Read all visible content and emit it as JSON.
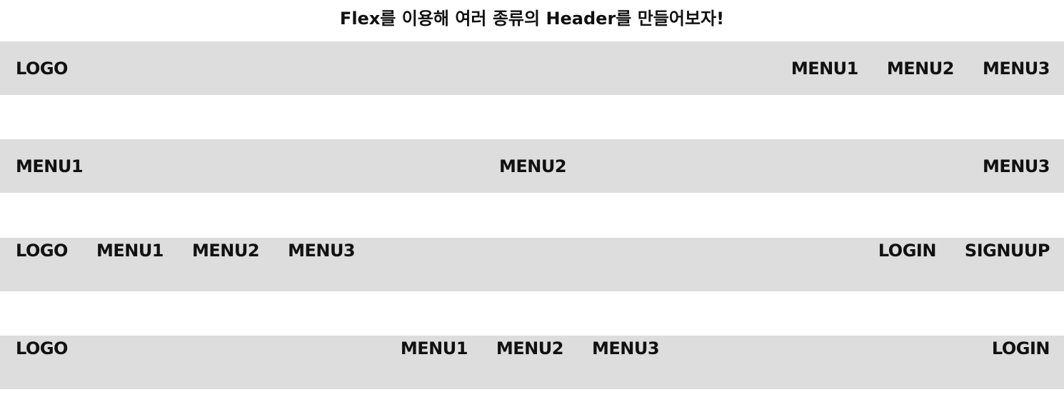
{
  "title": "Flex를 이용해 여러 종류의 Header를 만들어보자!",
  "colors": {
    "header_background": "#dddddd",
    "text": "#111111",
    "page_background": "#ffffff"
  },
  "header1": {
    "logo": "LOGO",
    "menus": [
      "MENU1",
      "MENU2",
      "MENU3"
    ]
  },
  "header2": {
    "menus": [
      "MENU1",
      "MENU2",
      "MENU3"
    ]
  },
  "header3": {
    "logo": "LOGO",
    "menus": [
      "MENU1",
      "MENU2",
      "MENU3"
    ],
    "login": "LOGIN",
    "signup": "SIGNUUP"
  },
  "header4": {
    "logo": "LOGO",
    "menus": [
      "MENU1",
      "MENU2",
      "MENU3"
    ],
    "login": "LOGIN"
  }
}
